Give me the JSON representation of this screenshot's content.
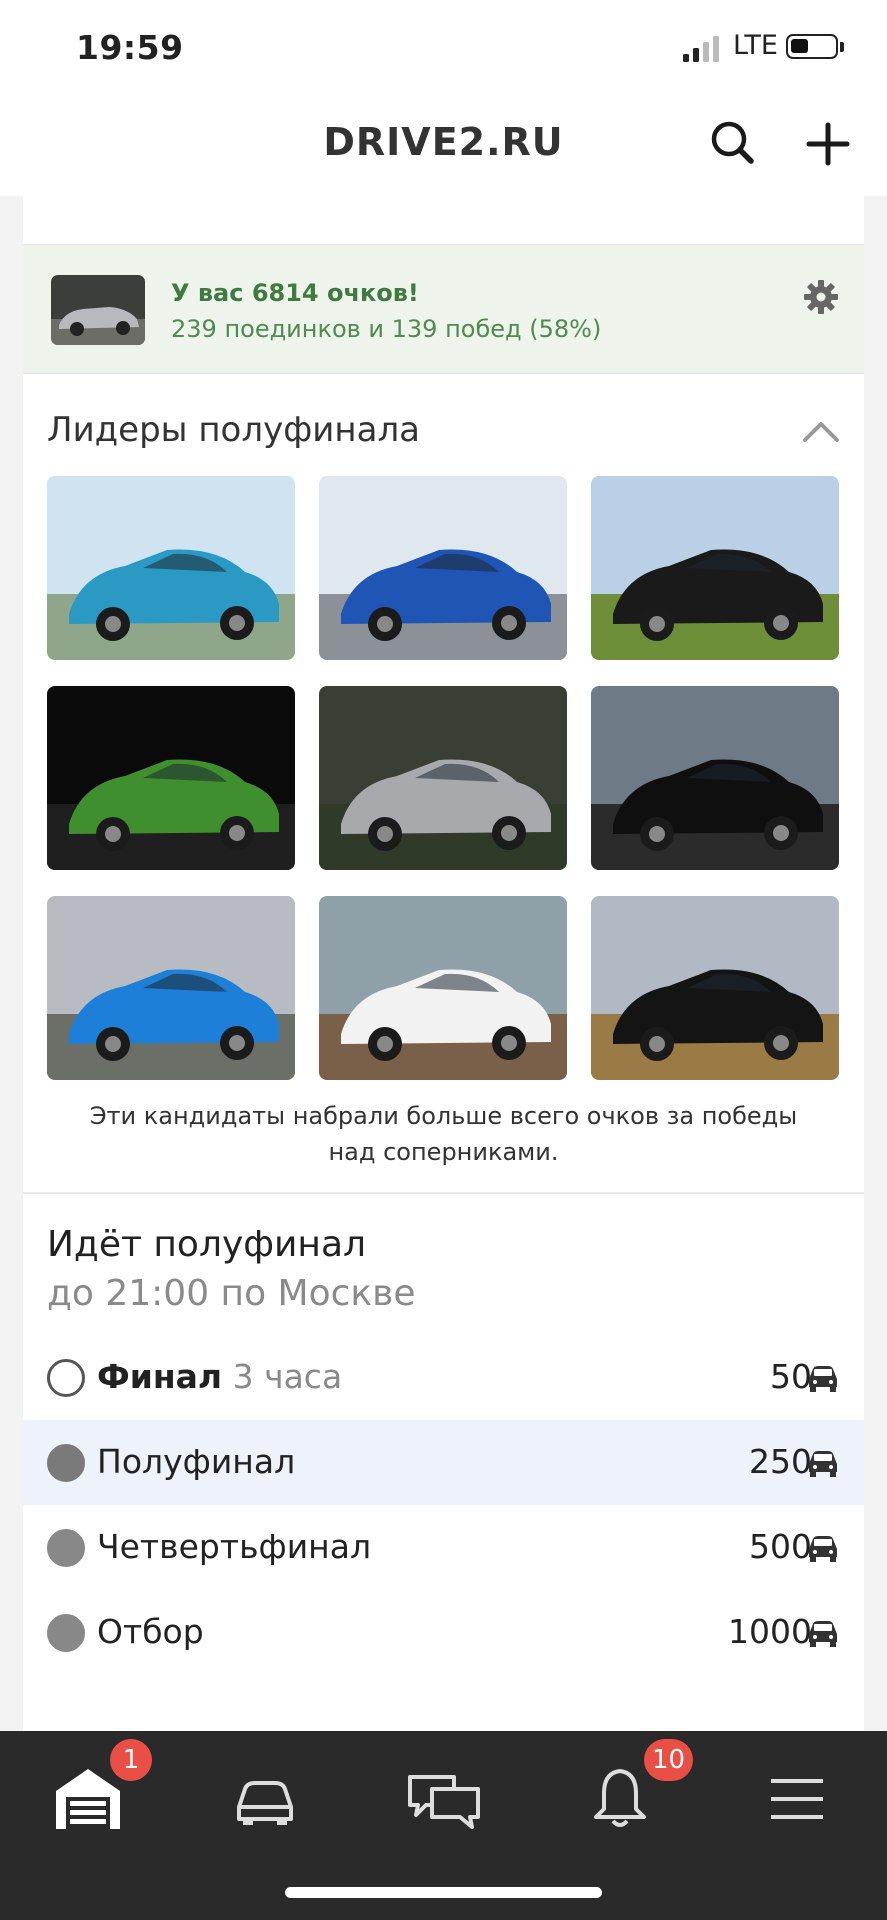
{
  "status_bar": {
    "time": "19:59",
    "network": "LTE",
    "battery_percent": 40
  },
  "header": {
    "brand": "DRIVE2.RU",
    "search_icon": "search-icon",
    "add_icon": "plus-icon"
  },
  "points_card": {
    "title": "У вас 6814 очков!",
    "subtitle": "239 поединков и 139 побед (58%)",
    "settings_icon": "gear-icon"
  },
  "leaders": {
    "title": "Лидеры полуфинала",
    "collapse_icon": "chevron-up-icon",
    "note": "Эти кандидаты набрали больше всего очков за победы над соперниками.",
    "cars": [
      {
        "desc": "light blue Porsche 911",
        "sky": "#cfe3f0",
        "ground": "#8fa68b",
        "car": "#2a9ac4"
      },
      {
        "desc": "blue Lexus sedan",
        "sky": "#dfe8ef",
        "ground": "#8c9097",
        "car": "#1f56b5"
      },
      {
        "desc": "black Audi wagon",
        "sky": "#b9d0e6",
        "ground": "#6e8e3a",
        "car": "#1a1a1a"
      },
      {
        "desc": "green Audi SUV",
        "sky": "#0a0a0a",
        "ground": "#1f1f1f",
        "car": "#3f8f2e"
      },
      {
        "desc": "silver sedan",
        "sky": "#3a3f35",
        "ground": "#2f3a28",
        "car": "#a7a9ad"
      },
      {
        "desc": "black Porsche",
        "sky": "#6e7a86",
        "ground": "#2b2b2b",
        "car": "#0f0f0f"
      },
      {
        "desc": "blue Audi hatchback",
        "sky": "#b8bcc2",
        "ground": "#6c6e68",
        "car": "#1e7fd8"
      },
      {
        "desc": "white Audi",
        "sky": "#8fa0a8",
        "ground": "#7a6048",
        "car": "#f2f2f2"
      },
      {
        "desc": "black sedan autumn",
        "sky": "#b0b9c4",
        "ground": "#9a7a45",
        "car": "#141414"
      }
    ]
  },
  "semifinal": {
    "title": "Идёт полуфинал",
    "subtitle": "до 21:00 по Москве",
    "stages": [
      {
        "name": "Финал",
        "duration": "3 часа",
        "count": "50",
        "state": "pending"
      },
      {
        "name": "Полуфинал",
        "duration": "",
        "count": "250",
        "state": "active"
      },
      {
        "name": "Четвертьфинал",
        "duration": "",
        "count": "500",
        "state": "done"
      },
      {
        "name": "Отбор",
        "duration": "",
        "count": "1000",
        "state": "done"
      }
    ]
  },
  "tabbar": {
    "tabs": [
      {
        "icon": "garage-icon",
        "badge": "1"
      },
      {
        "icon": "car-icon",
        "badge": ""
      },
      {
        "icon": "messages-icon",
        "badge": ""
      },
      {
        "icon": "bell-icon",
        "badge": "10"
      },
      {
        "icon": "menu-icon",
        "badge": ""
      }
    ]
  },
  "colors": {
    "accent_green": "#3f7a3f",
    "points_bg": "#eef4ec",
    "active_row": "#eef3fb",
    "badge_red": "#ea4f45",
    "tabbar_bg": "#2a2a2a"
  }
}
